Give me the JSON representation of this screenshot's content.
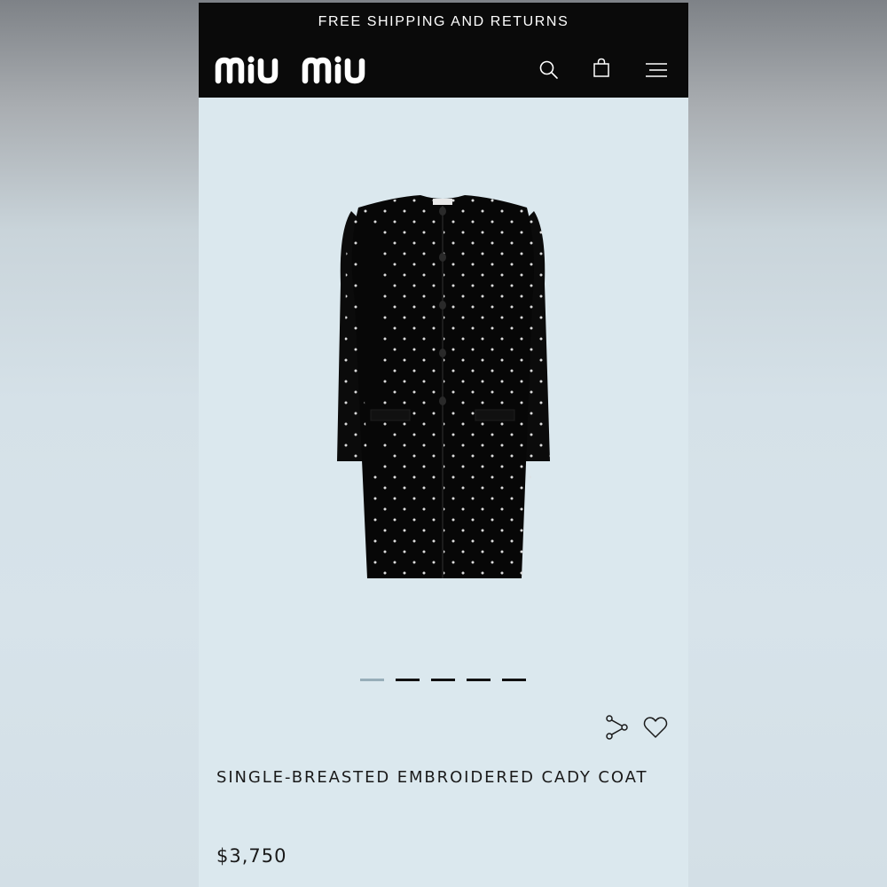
{
  "header": {
    "promo_text": "FREE SHIPPING AND RETURNS",
    "logo_text": "MIU MIU",
    "icons": [
      "search-icon",
      "bag-icon",
      "menu-icon"
    ]
  },
  "gallery": {
    "image_description": "single-breasted embroidered cady coat",
    "slides_total": 5,
    "active_slide": 1
  },
  "actions": {
    "icons": [
      "share-icon",
      "heart-icon"
    ]
  },
  "product": {
    "name": "SINGLE-BREASTED EMBROIDERED CADY COAT",
    "price": "$3,750"
  },
  "colors": {
    "header_bg": "#0a0a0a",
    "page_bg": "#dbe8ee",
    "active_indicator": "#97aeb9",
    "text": "#1a1a1a"
  }
}
